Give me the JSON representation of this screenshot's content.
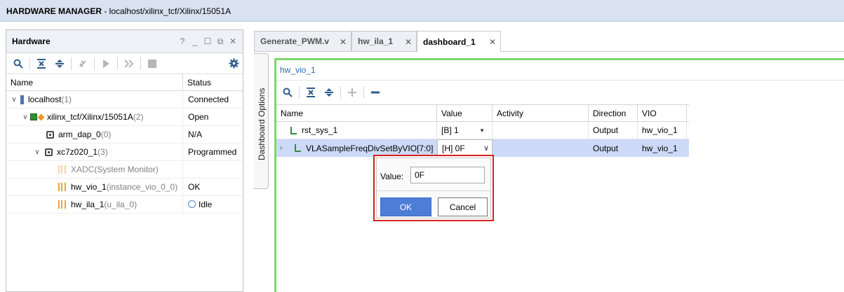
{
  "window": {
    "title_bold": "HARDWARE MANAGER",
    "title_rest": " - localhost/xilinx_tcf/Xilinx/15051A"
  },
  "hardware_panel": {
    "title": "Hardware",
    "controls": [
      "?",
      "_",
      "☐",
      "⧉",
      "✕"
    ],
    "columns": [
      "Name",
      "Status"
    ],
    "rows": [
      {
        "name": "localhost",
        "sub": " (1)",
        "status": "Connected"
      },
      {
        "name": "xilinx_tcf/Xilinx/15051A",
        "sub": " (2)",
        "status": "Open"
      },
      {
        "name": "arm_dap_0",
        "sub": " (0)",
        "status": "N/A"
      },
      {
        "name": "xc7z020_1",
        "sub": " (3)",
        "status": "Programmed"
      },
      {
        "name": "XADC",
        "sub": " (System Monitor)",
        "status": ""
      },
      {
        "name": "hw_vio_1",
        "sub": " (instance_vio_0_0)",
        "status": "OK"
      },
      {
        "name": "hw_ila_1",
        "sub": " (u_ila_0)",
        "status": "Idle"
      }
    ]
  },
  "tabs": [
    {
      "label": "Generate_PWM.v",
      "close": "✕"
    },
    {
      "label": "hw_ila_1",
      "close": "✕"
    },
    {
      "label": "dashboard_1",
      "close": "✕"
    }
  ],
  "dashboard_options_label": "Dashboard Options",
  "vio": {
    "title": "hw_vio_1",
    "columns": [
      "Name",
      "Value",
      "Activity",
      "Direction",
      "VIO"
    ],
    "rows": [
      {
        "name": "rst_sys_1",
        "value": "[B] 1",
        "activity": "",
        "direction": "Output",
        "vio": "hw_vio_1"
      },
      {
        "name": "VLASampleFreqDivSetByVIO[7:0]",
        "value": "[H] 0F",
        "activity": "",
        "direction": "Output",
        "vio": "hw_vio_1"
      }
    ]
  },
  "popup": {
    "label": "Value:",
    "input_value": "0F",
    "ok_label": "OK",
    "cancel_label": "Cancel"
  }
}
